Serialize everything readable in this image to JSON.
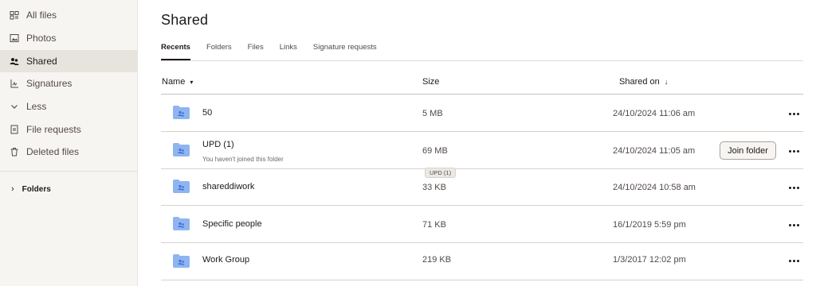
{
  "sidebar": {
    "items": [
      {
        "label": "All files",
        "icon": "all-files-icon"
      },
      {
        "label": "Photos",
        "icon": "photos-icon"
      },
      {
        "label": "Shared",
        "icon": "shared-icon",
        "active": true
      },
      {
        "label": "Signatures",
        "icon": "signature-icon"
      },
      {
        "label": "Less",
        "icon": "chevron-down-icon"
      },
      {
        "label": "File requests",
        "icon": "file-request-icon"
      },
      {
        "label": "Deleted files",
        "icon": "trash-icon"
      }
    ],
    "folders_label": "Folders"
  },
  "page": {
    "title": "Shared"
  },
  "tabs": [
    {
      "label": "Recents",
      "active": true
    },
    {
      "label": "Folders"
    },
    {
      "label": "Files"
    },
    {
      "label": "Links"
    },
    {
      "label": "Signature requests"
    }
  ],
  "table": {
    "headers": {
      "name": "Name",
      "name_sort": "▾",
      "size": "Size",
      "shared_on": "Shared on",
      "shared_sort": "↓"
    },
    "rows": [
      {
        "name": "50",
        "subtitle": "",
        "size": "5 MB",
        "shared_on": "24/10/2024 11:06 am"
      },
      {
        "name": "UPD (1)",
        "subtitle": "You haven't joined this folder",
        "size": "69 MB",
        "shared_on": "24/10/2024 11:05 am",
        "action": "Join folder"
      },
      {
        "name": "shareddiwork",
        "subtitle": "",
        "size": "33 KB",
        "shared_on": "24/10/2024 10:58 am"
      },
      {
        "name": "Specific people",
        "subtitle": "",
        "size": "71 KB",
        "shared_on": "16/1/2019 5:59 pm"
      },
      {
        "name": "Work Group",
        "subtitle": "",
        "size": "219 KB",
        "shared_on": "1/3/2017 12:02 pm"
      }
    ]
  },
  "tooltip": {
    "text": "UPD (1)"
  },
  "colors": {
    "folder": "#8fb4f0",
    "folder_dark": "#3d72d6",
    "sidebar_bg": "#f7f5f2",
    "active_bg": "#e7e3dd"
  }
}
